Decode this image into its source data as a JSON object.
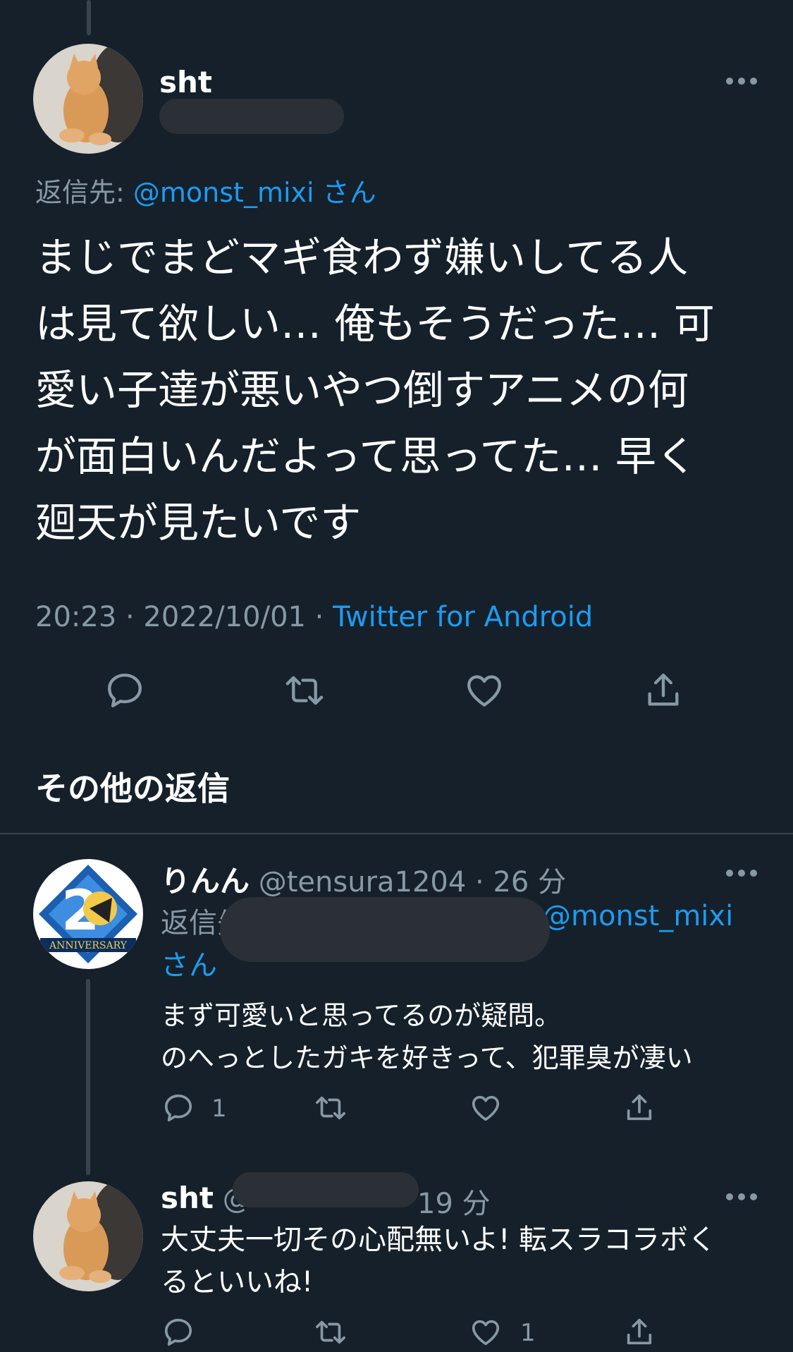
{
  "main_tweet": {
    "name": "sht",
    "reply_to_prefix": "返信先: ",
    "reply_to_handle": "@monst_mixi",
    "reply_to_suffix": " さん",
    "text_lines": [
      "まじでまどマギ食わず嫌いしてる人",
      "は見て欲しい… 俺もそうだった… 可",
      "愛い子達が悪いやつ倒すアニメの何",
      "が面白いんだよって思ってた… 早く",
      "廻天が見たいです"
    ],
    "meta_time": "20:23 · 2022/10/01 · ",
    "meta_source": "Twitter for Android",
    "icons": [
      "reply-icon",
      "retweet-icon",
      "like-icon",
      "share-icon"
    ]
  },
  "section_title": "その他の返信",
  "replies": [
    {
      "name": "りんん",
      "handle_time": "@tensura1204 · 26 分",
      "reply_to_prefix": "返信先",
      "reply_to_handle": "@monst_mixi",
      "reply_to_suffix": "さん",
      "text_lines": [
        "まず可愛いと思ってるのが疑問。",
        "のへっとしたガキを好きって、犯罪臭が凄い"
      ],
      "reply_count": "1",
      "like_count": ""
    },
    {
      "name": "sht",
      "handle_prefix": "@",
      "time": "19 分",
      "text_lines": [
        "大丈夫一切その心配無いよ! 転スラコラボく",
        "るといいね!"
      ],
      "reply_count": "",
      "like_count": "1"
    }
  ],
  "colors": {
    "background": "#15202b",
    "accent": "#1d9bf0",
    "muted": "#8899a6",
    "divider": "#38444d"
  }
}
